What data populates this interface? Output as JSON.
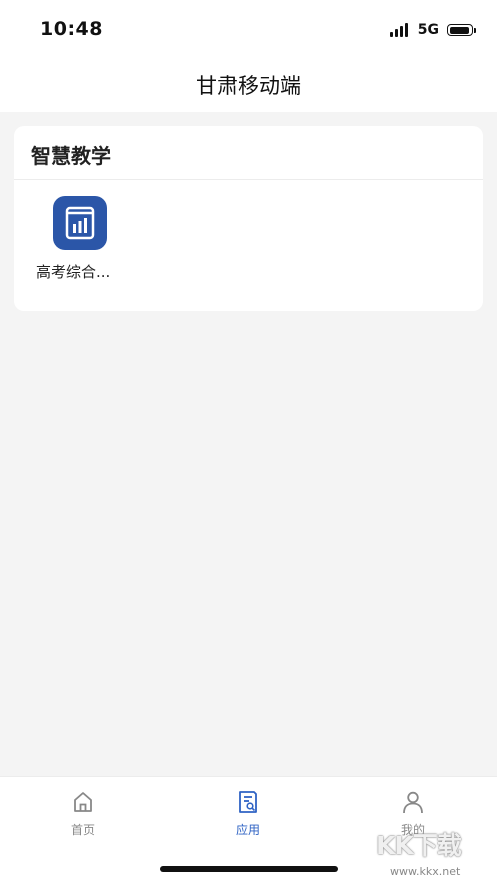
{
  "status_bar": {
    "time": "10:48",
    "network": "5G",
    "battery_level": 0.92
  },
  "header": {
    "title": "甘肃移动端"
  },
  "section": {
    "title": "智慧教学",
    "apps": [
      {
        "label": "高考综合...",
        "icon": "book-chart-icon",
        "color": "#2b56a8"
      }
    ]
  },
  "tabbar": {
    "tabs": [
      {
        "label": "首页",
        "icon": "home-icon",
        "active": false
      },
      {
        "label": "应用",
        "icon": "document-search-icon",
        "active": true
      },
      {
        "label": "我的",
        "icon": "user-icon",
        "active": false
      }
    ],
    "active_color": "#2f63c4",
    "inactive_color": "#888888"
  },
  "watermark": {
    "text": "KK下载",
    "url": "www.kkx.net"
  }
}
